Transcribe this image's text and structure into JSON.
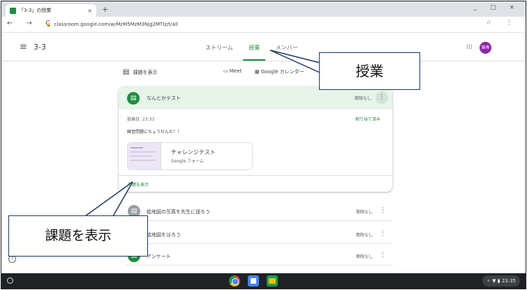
{
  "browser": {
    "tab_title": "「3-3」の授業",
    "tab_close": "×",
    "new_tab": "+",
    "window_controls": "_ ▢ ×",
    "nav_buttons": "← → C",
    "url": "classroom.google.com/w/MzM5MzM3Njg2MTIz/t/all",
    "address_icons": "☆ ⋮"
  },
  "header": {
    "menu_icon": "≡",
    "class_name": "3-3",
    "tabs": [
      "ストリーム",
      "授業",
      "メンバー"
    ],
    "apps_icon": "⁞⁞⁞",
    "avatar_initials": "架寿"
  },
  "toolbar": {
    "view_work_label": "課題を表示",
    "meet_label": "Meet",
    "calendar_label": "Google カレンダー"
  },
  "assignment": {
    "title": "なんとかテスト",
    "due": "期限なし",
    "posted": "投稿日: 23:33",
    "status": "割り当て済み",
    "instructions": "練習問題にちょうせんだ！！",
    "attachment_title": "チャレンジテスト",
    "attachment_type": "Google フォーム",
    "view_link": "課題を表示"
  },
  "items": [
    {
      "title": "絵地図の写真を先生に送ろう",
      "due": "期限なし"
    },
    {
      "title": "絵地図をはろう",
      "due": "期限なし"
    },
    {
      "title": "アンケート",
      "due": "期限なし"
    }
  ],
  "callouts": {
    "top": "授業",
    "bottom": "課題を表示"
  },
  "taskbar": {
    "clock": "23:35"
  },
  "colors": {
    "accent": "#1e8e3e",
    "callout_border": "#1f3763"
  }
}
